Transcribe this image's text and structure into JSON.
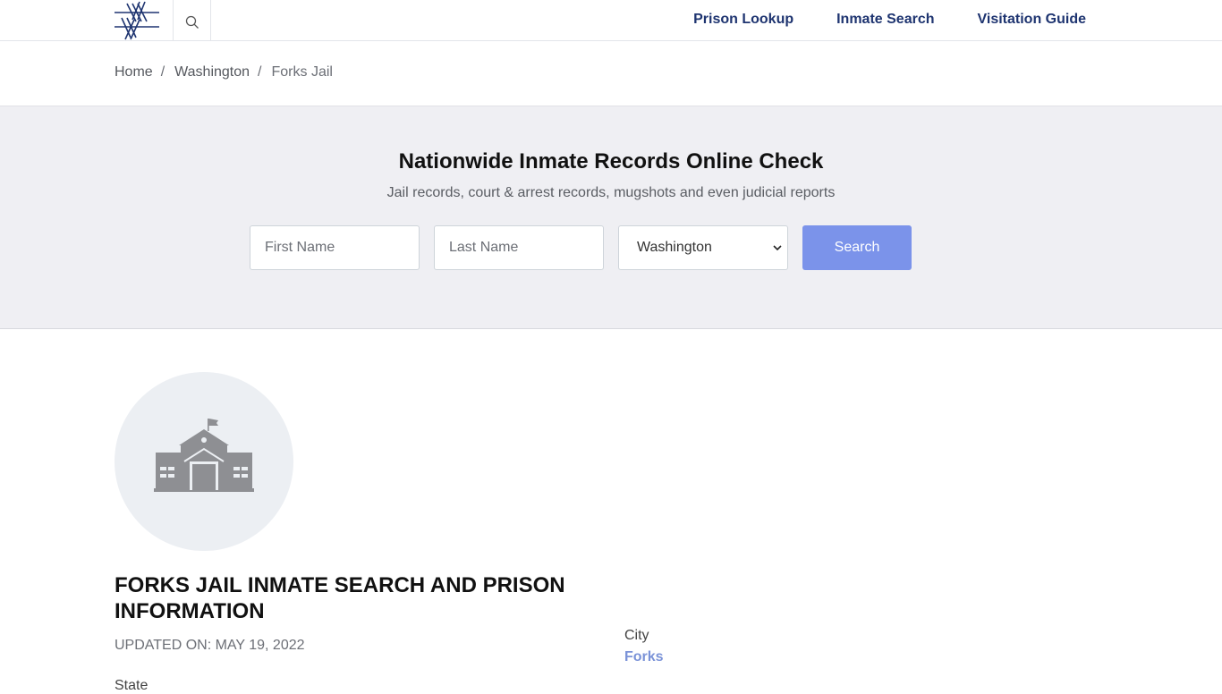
{
  "header": {
    "nav": [
      "Prison Lookup",
      "Inmate Search",
      "Visitation Guide"
    ]
  },
  "breadcrumb": [
    "Home",
    "Washington",
    "Forks Jail"
  ],
  "search_band": {
    "title": "Nationwide Inmate Records Online Check",
    "subtitle": "Jail records, court & arrest records, mugshots and even judicial reports",
    "first_name_placeholder": "First Name",
    "last_name_placeholder": "Last Name",
    "state_selected": "Washington",
    "button_label": "Search"
  },
  "facility": {
    "title": "FORKS JAIL INMATE SEARCH AND PRISON INFORMATION",
    "updated": "UPDATED ON: MAY 19, 2022",
    "state_label": "State",
    "city_label": "City",
    "city_value": "Forks"
  },
  "colors": {
    "nav_text": "#1e3470",
    "button_bg": "#7b93ea",
    "band_bg": "#efeff3",
    "link_accent": "#7b93d8"
  },
  "icons": [
    "barbed-wire-logo-icon",
    "search-icon",
    "chevron-down-icon",
    "courthouse-icon"
  ]
}
